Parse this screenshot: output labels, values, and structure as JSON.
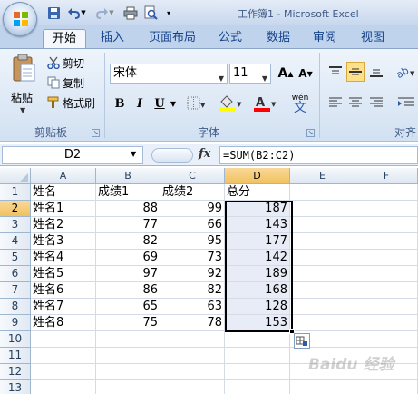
{
  "titlebar": {
    "title": "工作簿1 - Microsoft Excel",
    "icons": [
      "office-logo",
      "save-icon",
      "undo-icon",
      "redo-icon",
      "print-icon",
      "print-preview-icon",
      "customize-arrow-icon"
    ]
  },
  "tabs": [
    "开始",
    "插入",
    "页面布局",
    "公式",
    "数据",
    "审阅",
    "视图"
  ],
  "ribbon": {
    "clipboard": {
      "paste": "粘贴",
      "cut": "剪切",
      "copy": "复制",
      "format_painter": "格式刷",
      "group_label": "剪贴板"
    },
    "font": {
      "name": "宋体",
      "size": "11",
      "grow": "A",
      "shrink": "A",
      "bold": "B",
      "italic": "I",
      "underline": "U",
      "phonetic": "wén",
      "group_label": "字体"
    },
    "alignment": {
      "group_label": "对齐"
    },
    "colors": {
      "fill": "#ffff00",
      "font_color": "#ff0000",
      "accent": "#fde089"
    }
  },
  "formula_bar": {
    "name_box": "D2",
    "fx": "fx",
    "formula": "=SUM(B2:C2)"
  },
  "grid": {
    "columns": [
      "A",
      "B",
      "C",
      "D",
      "E",
      "F"
    ],
    "rows": [
      "1",
      "2",
      "3",
      "4",
      "5",
      "6",
      "7",
      "8",
      "9",
      "10",
      "11",
      "12",
      "13"
    ],
    "active_cell": "D2",
    "selected_column": "D",
    "cells": [
      [
        "姓名",
        "成绩1",
        "成绩2",
        "总分"
      ],
      [
        "姓名1",
        "88",
        "99",
        "187"
      ],
      [
        "姓名2",
        "77",
        "66",
        "143"
      ],
      [
        "姓名3",
        "82",
        "95",
        "177"
      ],
      [
        "姓名4",
        "69",
        "73",
        "142"
      ],
      [
        "姓名5",
        "97",
        "92",
        "189"
      ],
      [
        "姓名6",
        "86",
        "82",
        "168"
      ],
      [
        "姓名7",
        "65",
        "63",
        "128"
      ],
      [
        "姓名8",
        "75",
        "78",
        "153"
      ]
    ]
  },
  "watermark": "Baidu 经验"
}
